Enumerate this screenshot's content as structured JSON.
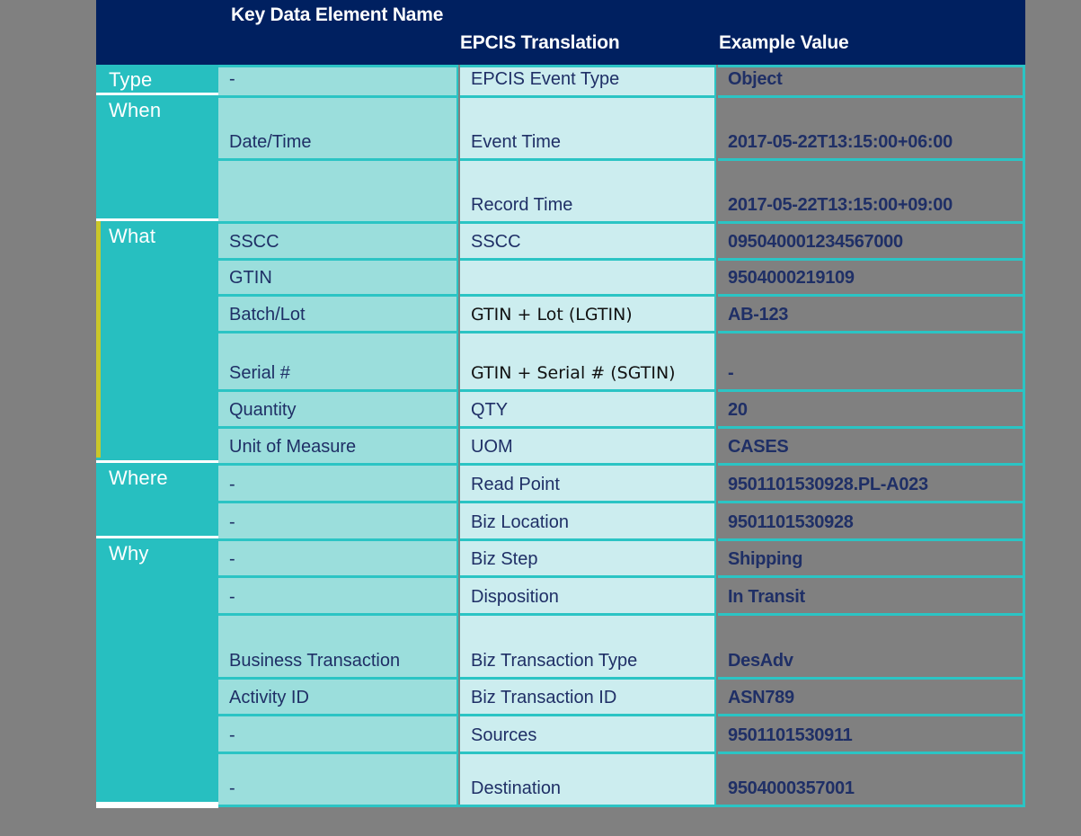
{
  "table": {
    "header": {
      "col_group": "",
      "col_kde_name": "Key Data Element Name",
      "col_epcis_translation": "EPCIS Translation",
      "col_example_value": "Example Value"
    },
    "colors": {
      "background": "#808080",
      "header_band": "#002060",
      "group_column": "#27BFC0",
      "name_column": "#9BDEDC",
      "translation_column": "#CCEDEF",
      "gridline": "#2BC4C4",
      "accent_bar": "#C9C72A",
      "text_navy": "#1F2F66",
      "text_white": "#FFFFFF"
    },
    "groups": [
      {
        "label": "Type",
        "accent": false
      },
      {
        "label": "When",
        "accent": false
      },
      {
        "label": "What",
        "accent": true
      },
      {
        "label": "Where",
        "accent": false
      },
      {
        "label": "Why",
        "accent": false
      }
    ],
    "rows": [
      {
        "group": "Type",
        "name": "-",
        "translation": "EPCIS Event Type",
        "value": "Object"
      },
      {
        "group": "When",
        "name": "Date/Time",
        "translation": "Event Time",
        "value": "2017-05-22T13:15:00+06:00"
      },
      {
        "group": "When",
        "name": "",
        "translation": "Record Time",
        "value": "2017-05-22T13:15:00+09:00"
      },
      {
        "group": "What",
        "name": "SSCC",
        "translation": "SSCC",
        "value": "095040001234567000"
      },
      {
        "group": "What",
        "name": "GTIN",
        "translation": "",
        "value": "9504000219109"
      },
      {
        "group": "What",
        "name": "Batch/Lot",
        "translation": "GTIN + Lot (LGTIN)",
        "value": "AB-123"
      },
      {
        "group": "What",
        "name": "Serial #",
        "translation": "GTIN + Serial # (SGTIN)",
        "value": "-"
      },
      {
        "group": "What",
        "name": "Quantity",
        "translation": "QTY",
        "value": "20"
      },
      {
        "group": "What",
        "name": "Unit of Measure",
        "translation": "UOM",
        "value": "CASES"
      },
      {
        "group": "Where",
        "name": "-",
        "translation": "Read Point",
        "value": "9501101530928.PL-A023"
      },
      {
        "group": "Where",
        "name": "-",
        "translation": "Biz Location",
        "value": "9501101530928"
      },
      {
        "group": "Why",
        "name": "-",
        "translation": "Biz Step",
        "value": "Shipping"
      },
      {
        "group": "Why",
        "name": "-",
        "translation": "Disposition",
        "value": "In Transit"
      },
      {
        "group": "Why",
        "name": "Business Transaction",
        "translation": "Biz Transaction Type",
        "value": "DesAdv"
      },
      {
        "group": "Why",
        "name": "Activity ID",
        "translation": "Biz Transaction ID",
        "value": "ASN789"
      },
      {
        "group": "Why",
        "name": "-",
        "translation": "Sources",
        "value": "9501101530911"
      },
      {
        "group": "Why",
        "name": "-",
        "translation": "Destination",
        "value": "9504000357001"
      }
    ]
  }
}
